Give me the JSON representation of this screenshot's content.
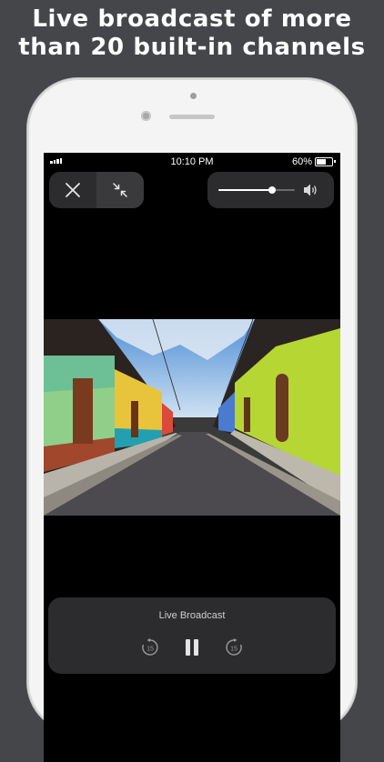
{
  "headline": {
    "line1": "Live broadcast of more",
    "line2": "than 20 built-in channels"
  },
  "status_bar": {
    "time": "10:10 PM",
    "battery_percent": "60%",
    "battery_level": 0.6
  },
  "controls": {
    "close_icon": "close-icon",
    "shrink_icon": "minimize-arrows-icon",
    "volume_icon": "speaker-volume-icon",
    "volume_level": 0.7
  },
  "video": {
    "scene": "street-photo",
    "colors": {
      "left_wall": "#7ac9a0",
      "right_wall": "#b6d633",
      "sky": "#6ea6dc"
    }
  },
  "player": {
    "title": "Live Broadcast",
    "rewind_label": "15",
    "forward_label": "15",
    "state": "playing"
  },
  "colors": {
    "background": "#454649",
    "panel": "#2c2c2e",
    "accent": "#ffffff"
  }
}
